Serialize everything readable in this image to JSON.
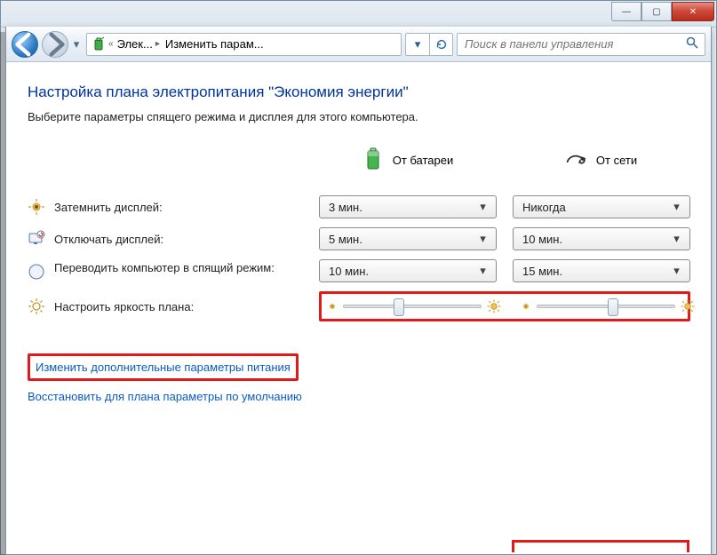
{
  "window_controls": {
    "min": "—",
    "max": "▢",
    "close": "✕"
  },
  "breadcrumb": {
    "icon_name": "power-options-icon",
    "seg1": "Элек...",
    "seg2": "Изменить парам..."
  },
  "search": {
    "placeholder": "Поиск в панели управления"
  },
  "page": {
    "title": "Настройка плана электропитания \"Экономия энергии\"",
    "subtitle": "Выберите параметры спящего режима и дисплея для этого компьютера."
  },
  "columns": {
    "battery": "От батареи",
    "plugged": "От сети"
  },
  "rows": {
    "dim": {
      "label": "Затемнить дисплей:",
      "battery": "3 мин.",
      "plugged": "Никогда"
    },
    "off": {
      "label": "Отключать дисплей:",
      "battery": "5 мин.",
      "plugged": "10 мин."
    },
    "sleep": {
      "label": "Переводить компьютер в спящий режим:",
      "battery": "10 мин.",
      "plugged": "15 мин."
    },
    "bright": {
      "label": "Настроить яркость плана:"
    }
  },
  "brightness": {
    "battery_percent": 40,
    "plugged_percent": 55
  },
  "links": {
    "advanced": "Изменить дополнительные параметры питания",
    "restore": "Восстановить для плана параметры по умолчанию"
  }
}
